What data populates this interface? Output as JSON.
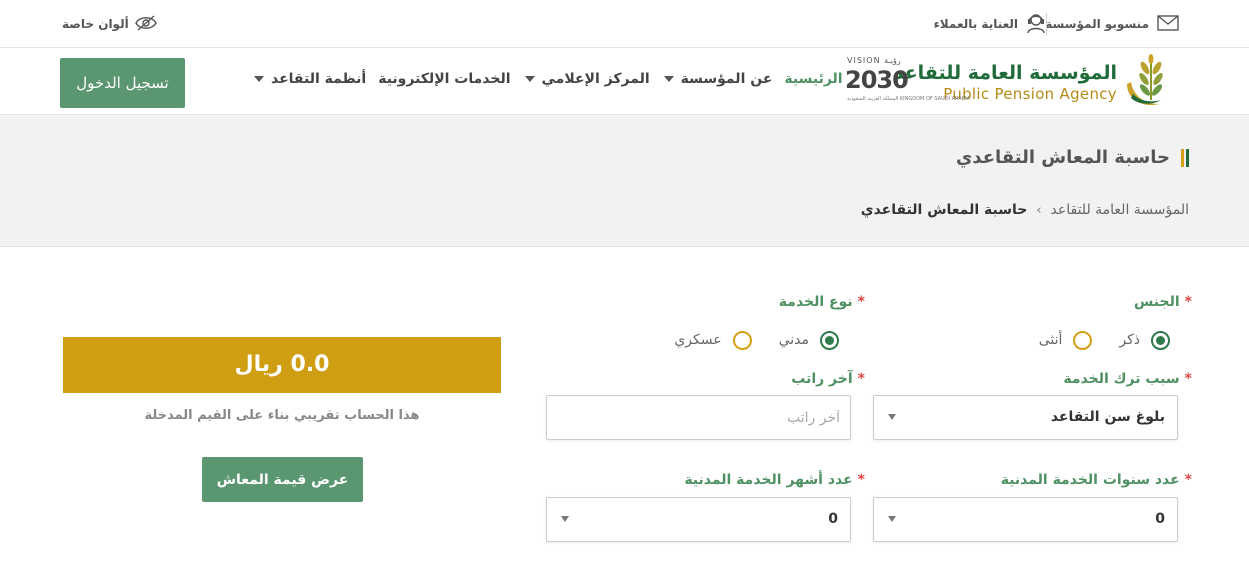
{
  "topbar": {
    "staff_label": "منسوبو المؤسسة",
    "staff_icon": "envelope-icon",
    "customer_care_label": "العناية بالعملاء",
    "customer_care_icon": "customer-care-icon",
    "special_colors_label": "ألوان خاصة",
    "special_colors_icon": "eye-off-icon"
  },
  "logo": {
    "arabic": "المؤسسة العامة للتقاعد",
    "english": "Public Pension Agency",
    "emblem_icon": "wheat-crescent-emblem"
  },
  "vision": {
    "top": "VISION رؤيـة",
    "number": "2030",
    "sub": "المملكة العربية السعودية KINGDOM OF SAUDI ARABIA"
  },
  "nav": {
    "items": [
      {
        "label": "الرئيسية",
        "active": true,
        "dropdown": false
      },
      {
        "label": "عن المؤسسة",
        "active": false,
        "dropdown": true
      },
      {
        "label": "المركز الإعلامي",
        "active": false,
        "dropdown": true
      },
      {
        "label": "الخدمات الإلكترونية",
        "active": false,
        "dropdown": false
      },
      {
        "label": "أنظمة التقاعد",
        "active": false,
        "dropdown": true
      }
    ],
    "login_label": "تسجيل الدخول"
  },
  "page": {
    "title": "حاسبة المعاش التقاعدي",
    "breadcrumb": {
      "home": "المؤسسة العامة للتقاعد",
      "separator": "›",
      "current": "حاسبة المعاش التقاعدي"
    }
  },
  "form": {
    "required_mark": "*",
    "gender": {
      "label": "الجنس",
      "options": [
        {
          "label": "ذكر",
          "checked": true
        },
        {
          "label": "أنثى",
          "checked": false
        }
      ]
    },
    "service_type": {
      "label": "نوع الخدمة",
      "options": [
        {
          "label": "مدني",
          "checked": true
        },
        {
          "label": "عسكري",
          "checked": false
        }
      ]
    },
    "leave_reason": {
      "label": "سبب ترك الخدمة",
      "value": "بلوغ سن التقاعد"
    },
    "last_salary": {
      "label": "آخر راتب",
      "placeholder": "آخر راتب",
      "value": ""
    },
    "service_years": {
      "label": "عدد سنوات الخدمة المدنية",
      "value": "0"
    },
    "service_months": {
      "label": "عدد أشهر الخدمة المدنية",
      "value": "0"
    }
  },
  "result": {
    "amount": "0.0 ريال",
    "note": "هذا الحساب تقريبي بناء على القيم المدخلة",
    "button_label": "عرض قيمة المعاش"
  },
  "colors": {
    "primary_green": "#5a9670",
    "dark_green": "#1f6b3a",
    "gold": "#cf9e13",
    "required_red": "#e04848"
  }
}
